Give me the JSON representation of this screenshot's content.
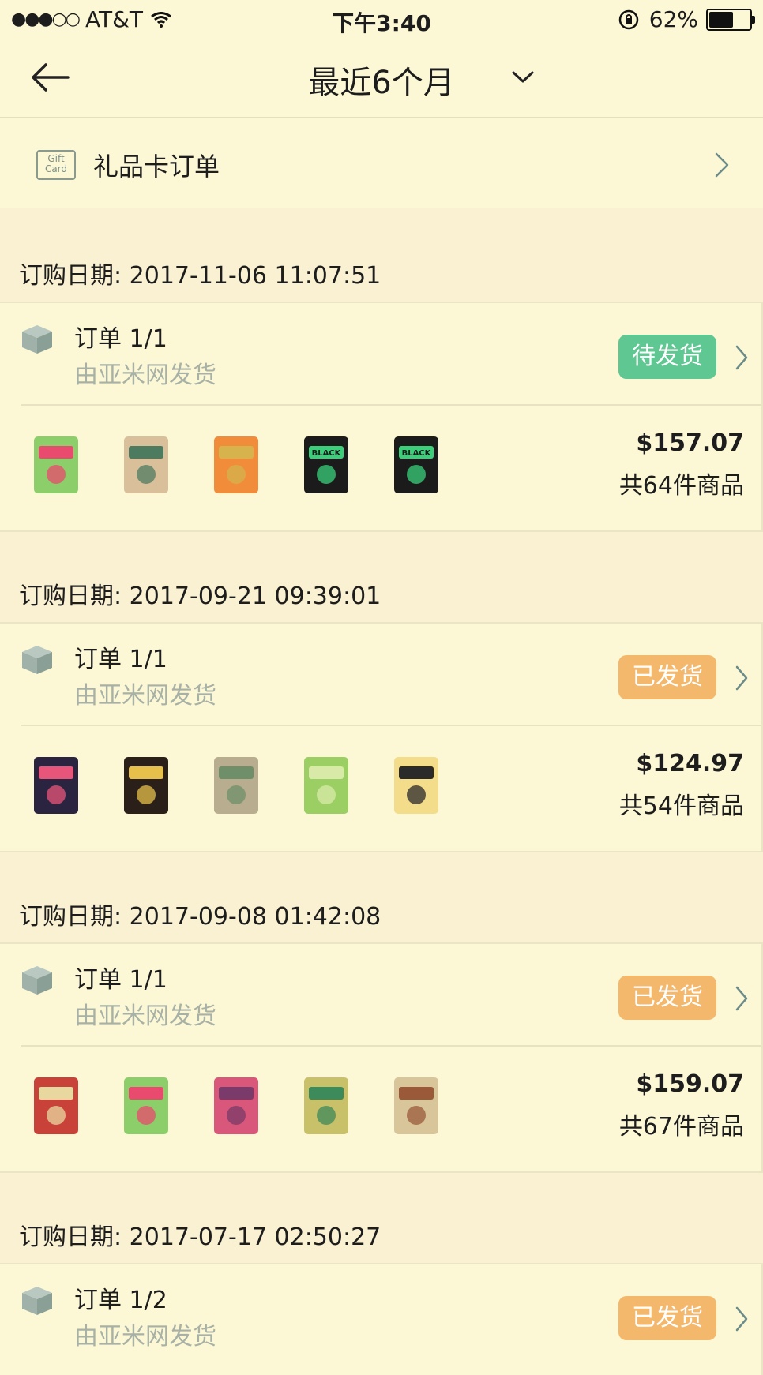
{
  "status_bar": {
    "carrier": "AT&T",
    "signal_dots": "●●●○○",
    "time": "下午3:40",
    "battery_percent": "62%",
    "battery_level": 0.62
  },
  "nav": {
    "title": "最近6个月"
  },
  "gift_card": {
    "icon_text_line1": "Gift",
    "icon_text_line2": "Card",
    "label": "礼品卡订单"
  },
  "orders": [
    {
      "date": "订购日期: 2017-11-06 11:07:51",
      "order_no": "订单 1/1",
      "shipper": "由亚米网发货",
      "status": "待发货",
      "status_color": "#5fc792",
      "price": "$157.07",
      "count": "共64件商品",
      "thumbs": [
        {
          "name": "snack-pack-thumb",
          "color": "#8ccf6a",
          "accent": "#e94b6e",
          "text": ""
        },
        {
          "name": "tofu-snack-thumb",
          "color": "#d9c09a",
          "accent": "#4d7b5f",
          "text": ""
        },
        {
          "name": "noodle-pack-thumb",
          "color": "#f08c3a",
          "accent": "#d6b34d",
          "text": ""
        },
        {
          "name": "black-mask-thumb",
          "color": "#1b1b1b",
          "accent": "#3ad07a",
          "text": "BLACK"
        },
        {
          "name": "black-mask-thumb-2",
          "color": "#1b1b1b",
          "accent": "#3ad07a",
          "text": "BLACK"
        }
      ]
    },
    {
      "date": "订购日期: 2017-09-21 09:39:01",
      "order_no": "订单 1/1",
      "shipper": "由亚米网发货",
      "status": "已发货",
      "status_color": "#f4b86c",
      "price": "$124.97",
      "count": "共54件商品",
      "thumbs": [
        {
          "name": "seaweed-jar-thumb",
          "color": "#2a2440",
          "accent": "#e8557a",
          "text": ""
        },
        {
          "name": "chili-oil-jar-thumb",
          "color": "#2b1f1a",
          "accent": "#e6c04a",
          "text": ""
        },
        {
          "name": "grain-bag-thumb",
          "color": "#b8ad8e",
          "accent": "#6f8f6a",
          "text": ""
        },
        {
          "name": "green-snack-thumb",
          "color": "#9bcf63",
          "accent": "#d8e9a8",
          "text": ""
        },
        {
          "name": "yellow-mask-thumb",
          "color": "#f3dc8a",
          "accent": "#2a2a2a",
          "text": ""
        }
      ]
    },
    {
      "date": "订购日期: 2017-09-08 01:42:08",
      "order_no": "订单 1/1",
      "shipper": "由亚米网发货",
      "status": "已发货",
      "status_color": "#f4b86c",
      "price": "$159.07",
      "count": "共67件商品",
      "thumbs": [
        {
          "name": "luncheon-meat-thumb",
          "color": "#c8423a",
          "accent": "#e8d8a0",
          "text": ""
        },
        {
          "name": "snack-pack-thumb-2",
          "color": "#8ccf6a",
          "accent": "#e94b6e",
          "text": ""
        },
        {
          "name": "congee-can-thumb",
          "color": "#d9577a",
          "accent": "#7a3a6a",
          "text": ""
        },
        {
          "name": "tea-can-thumb",
          "color": "#c9c06a",
          "accent": "#3d8a5a",
          "text": ""
        },
        {
          "name": "pastry-pack-thumb",
          "color": "#d8c59a",
          "accent": "#9a5a3a",
          "text": ""
        }
      ]
    },
    {
      "date": "订购日期: 2017-07-17 02:50:27",
      "order_no": "订单 1/2",
      "shipper": "由亚米网发货",
      "status": "已发货",
      "status_color": "#f4b86c"
    }
  ]
}
